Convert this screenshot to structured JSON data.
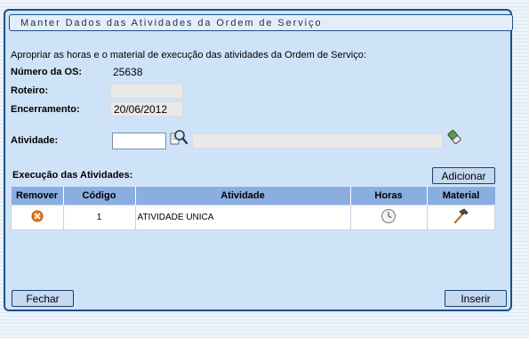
{
  "window": {
    "title": "Manter Dados das Atividades da Ordem de Serviço",
    "instructions": "Apropriar as horas e o material de execução das atividades da Ordem de Serviço:"
  },
  "form": {
    "os_label": "Número da OS:",
    "os_value": "25638",
    "roteiro_label": "Roteiro:",
    "roteiro_value": "",
    "encerramento_label": "Encerramento:",
    "encerramento_value": "20/06/2012",
    "atividade_label": "Atividade:",
    "atividade_code": "",
    "atividade_desc": ""
  },
  "execucao": {
    "title": "Execução das Atividades:",
    "add_label": "Adicionar",
    "columns": [
      "Remover",
      "Código",
      "Atividade",
      "Horas",
      "Material"
    ],
    "rows": [
      {
        "codigo": "1",
        "atividade": "ATIVIDADE UNICA"
      }
    ]
  },
  "icons": {
    "search": "magnifier-icon",
    "clear": "eraser-icon",
    "remove": "remove-x-icon",
    "hours": "clock-icon",
    "material": "hammer-icon"
  },
  "colors": {
    "panel_border": "#1b4f86",
    "panel_bg": "#cfe3f8",
    "header_bg": "#8aaee0",
    "remove_icon": "#e87a1e"
  },
  "footer": {
    "close_label": "Fechar",
    "insert_label": "Inserir"
  }
}
